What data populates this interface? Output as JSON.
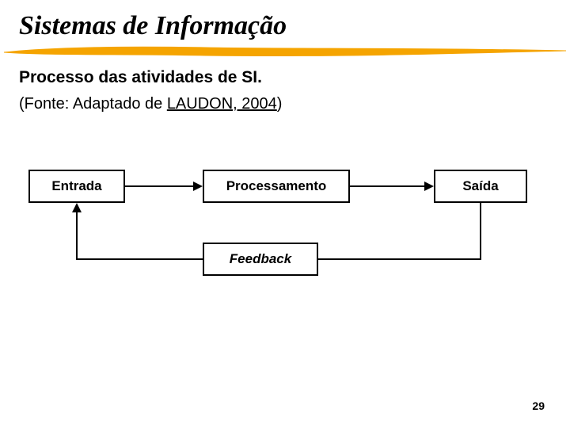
{
  "title": "Sistemas de Informação",
  "subtitle": "Processo das atividades de SI.",
  "source_prefix": "(Fonte: Adaptado de ",
  "source_link": "LAUDON, 2004",
  "source_suffix": ")",
  "boxes": {
    "entrada": "Entrada",
    "processamento": "Processamento",
    "saida": "Saída",
    "feedback": "Feedback"
  },
  "page_number": "29",
  "colors": {
    "stroke_accent": "#f5a400"
  }
}
